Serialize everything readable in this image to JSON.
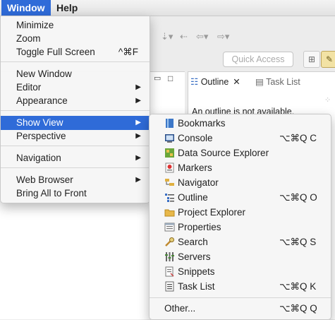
{
  "menubar": {
    "window": "Window",
    "help": "Help"
  },
  "background": {
    "quick_access": "Quick Access",
    "tab_outline": "Outline",
    "tab_task_list": "Task List",
    "outline_note": "An outline is not available."
  },
  "window_menu": {
    "items": [
      {
        "label": "Minimize",
        "shortcut": "",
        "submenu": false
      },
      {
        "label": "Zoom",
        "shortcut": "",
        "submenu": false
      },
      {
        "label": "Toggle Full Screen",
        "shortcut": "^⌘F",
        "submenu": false
      },
      {
        "label": "New Window",
        "shortcut": "",
        "submenu": false
      },
      {
        "label": "Editor",
        "shortcut": "",
        "submenu": true
      },
      {
        "label": "Appearance",
        "shortcut": "",
        "submenu": true
      },
      {
        "label": "Show View",
        "shortcut": "",
        "submenu": true,
        "selected": true
      },
      {
        "label": "Perspective",
        "shortcut": "",
        "submenu": true
      },
      {
        "label": "Navigation",
        "shortcut": "",
        "submenu": true
      },
      {
        "label": "Web Browser",
        "shortcut": "",
        "submenu": true
      },
      {
        "label": "Bring All to Front",
        "shortcut": "",
        "submenu": false
      }
    ]
  },
  "show_view_menu": {
    "items": [
      {
        "label": "Bookmarks",
        "shortcut": "",
        "icon": "bookmarks-icon"
      },
      {
        "label": "Console",
        "shortcut": "⌥⌘Q C",
        "icon": "console-icon"
      },
      {
        "label": "Data Source Explorer",
        "shortcut": "",
        "icon": "data-source-explorer-icon"
      },
      {
        "label": "Markers",
        "shortcut": "",
        "icon": "markers-icon"
      },
      {
        "label": "Navigator",
        "shortcut": "",
        "icon": "navigator-icon"
      },
      {
        "label": "Outline",
        "shortcut": "⌥⌘Q O",
        "icon": "outline-icon"
      },
      {
        "label": "Project Explorer",
        "shortcut": "",
        "icon": "project-explorer-icon"
      },
      {
        "label": "Properties",
        "shortcut": "",
        "icon": "properties-icon"
      },
      {
        "label": "Search",
        "shortcut": "⌥⌘Q S",
        "icon": "search-icon"
      },
      {
        "label": "Servers",
        "shortcut": "",
        "icon": "servers-icon"
      },
      {
        "label": "Snippets",
        "shortcut": "",
        "icon": "snippets-icon"
      },
      {
        "label": "Task List",
        "shortcut": "⌥⌘Q K",
        "icon": "task-list-icon"
      }
    ],
    "other": {
      "label": "Other...",
      "shortcut": "⌥⌘Q Q"
    }
  },
  "colors": {
    "selection": "#2f6bd8",
    "menu_bg": "#f6f6f6"
  }
}
